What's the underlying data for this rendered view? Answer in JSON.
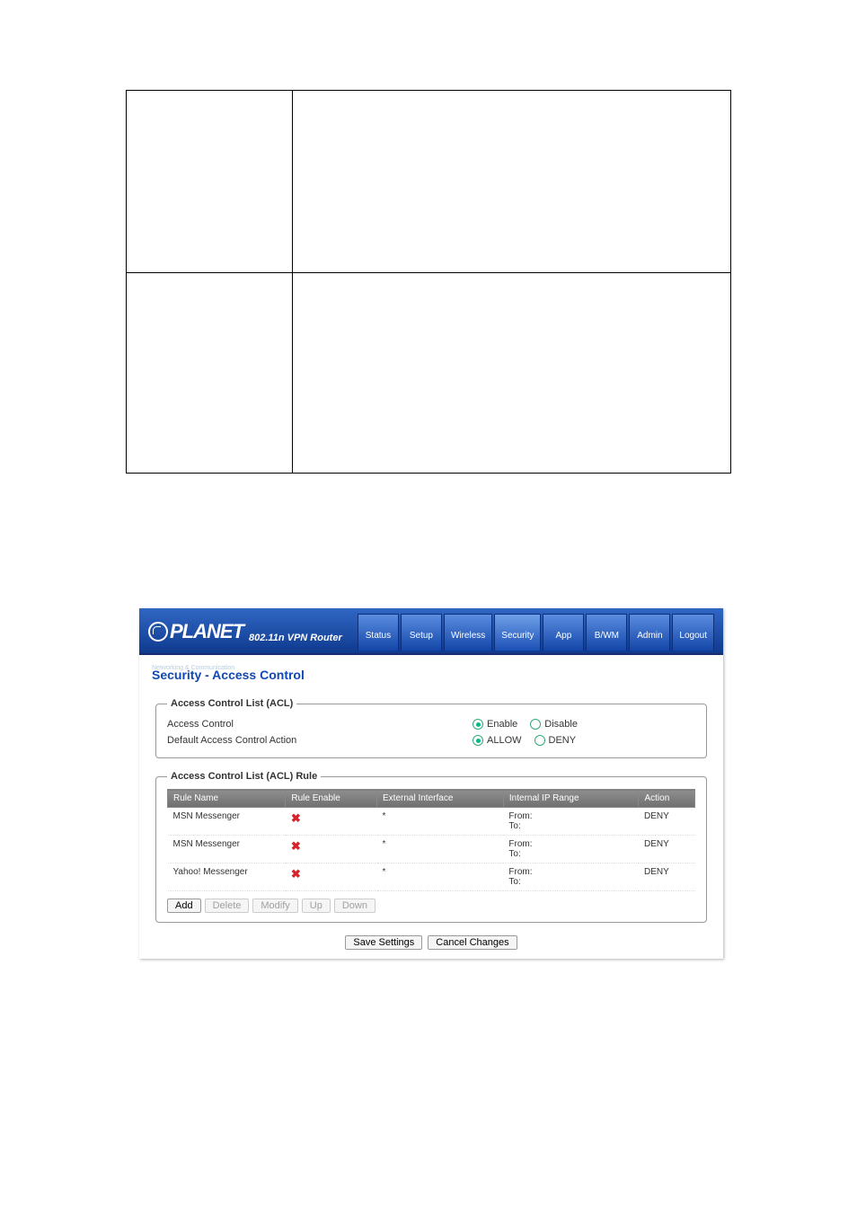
{
  "top_table": {
    "rows": 2,
    "cols": 2
  },
  "router": {
    "brand": "PLANET",
    "brand_tagline": "Networking & Communication",
    "product": "802.11n VPN Router",
    "nav": [
      "Status",
      "Setup",
      "Wireless",
      "Security",
      "App",
      "B/WM",
      "Admin",
      "Logout"
    ],
    "nav_active_index": 3,
    "page_title": "Security - Access Control",
    "acl_panel": {
      "legend": "Access Control List (ACL)",
      "rows": [
        {
          "label": "Access Control",
          "options": [
            "Enable",
            "Disable"
          ],
          "selected": 0
        },
        {
          "label": "Default Access Control Action",
          "options": [
            "ALLOW",
            "DENY"
          ],
          "selected": 0
        }
      ]
    },
    "rules_panel": {
      "legend": "Access Control List (ACL) Rule",
      "columns": [
        "Rule Name",
        "Rule Enable",
        "External Interface",
        "Internal IP Range",
        "Action"
      ],
      "rows": [
        {
          "name": "MSN Messenger",
          "enable": false,
          "external": "*",
          "from": "",
          "to": "",
          "action": "DENY"
        },
        {
          "name": "MSN Messenger",
          "enable": false,
          "external": "*",
          "from": "",
          "to": "",
          "action": "DENY"
        },
        {
          "name": "Yahoo! Messenger",
          "enable": false,
          "external": "*",
          "from": "",
          "to": "",
          "action": "DENY"
        }
      ],
      "ip_from_label": "From:",
      "ip_to_label": "To:",
      "buttons": [
        "Add",
        "Delete",
        "Modify",
        "Up",
        "Down"
      ],
      "buttons_enabled": [
        true,
        false,
        false,
        false,
        false
      ]
    },
    "bottom_buttons": [
      "Save Settings",
      "Cancel Changes"
    ]
  }
}
